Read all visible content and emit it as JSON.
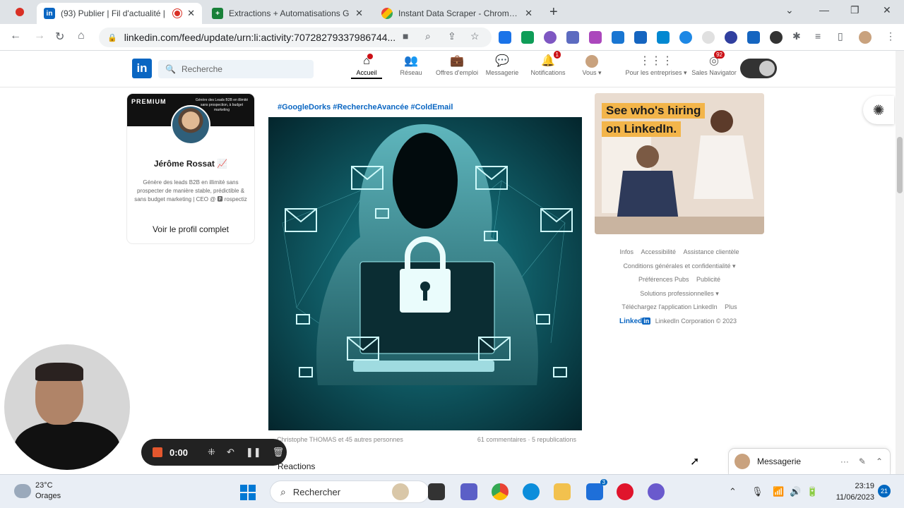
{
  "browser": {
    "tabs": [
      {
        "title": "(93) Publier | Fil d'actualité |",
        "favicon_color": "#0a66c2",
        "favicon_text": "in",
        "active": true
      },
      {
        "title": "Extractions + Automatisations G",
        "favicon_color": "#188038",
        "favicon_text": "+",
        "active": false
      },
      {
        "title": "Instant Data Scraper - Chrome W",
        "favicon_color": "#f4b400",
        "favicon_text": "",
        "active": false
      }
    ],
    "url": "linkedin.com/feed/update/urn:li:activity:70728279337986744..."
  },
  "linkedin": {
    "logo_text": "in",
    "search_placeholder": "Recherche",
    "nav": [
      {
        "label": "Accueil",
        "icon": "home-icon",
        "glyph": "⌂",
        "badge": "",
        "active": true
      },
      {
        "label": "Réseau",
        "icon": "network-icon",
        "glyph": "👥",
        "badge": "",
        "active": false
      },
      {
        "label": "Offres d'emploi",
        "icon": "briefcase-icon",
        "glyph": "💼",
        "badge": "",
        "active": false
      },
      {
        "label": "Messagerie",
        "icon": "messaging-icon",
        "glyph": "💬",
        "badge": "",
        "active": false
      },
      {
        "label": "Notifications",
        "icon": "bell-icon",
        "glyph": "🔔",
        "badge": "1",
        "active": false
      },
      {
        "label": "Vous ▾",
        "icon": "avatar-icon",
        "glyph": "",
        "badge": "",
        "active": false
      },
      {
        "label": "Pour les entreprises ▾",
        "icon": "grid-icon",
        "glyph": "⋮⋮⋮",
        "badge": "",
        "active": false
      },
      {
        "label": "Sales Navigator",
        "icon": "compass-icon",
        "glyph": "◎",
        "badge": "92",
        "active": false
      }
    ]
  },
  "profile": {
    "banner_label": "PREMIUM",
    "banner_text": "Génère des Leads B2B en illimité sans prospection, à budget marketing",
    "name": "Jérôme Rossat 📈",
    "bio": "Génère des leads B2B en illimité sans prospecter de manière stable, prédictible & sans budget marketing | CEO @ 🅿 rospectiz",
    "view_profile": "Voir le profil complet"
  },
  "post": {
    "hashtags": "#GoogleDorks #RechercheAvancée #ColdEmail",
    "reactions_summary": "Christophe THOMAS et 45 autres personnes",
    "comments_reposts": "61 commentaires · 5 republications",
    "reactions_title": "Reactions"
  },
  "ad": {
    "line1": "See who's hiring",
    "line2": "on LinkedIn."
  },
  "footer": {
    "row1": [
      "Infos",
      "Accessibilité",
      "Assistance clientèle"
    ],
    "row2": "Conditions générales et confidentialité ▾",
    "row3": [
      "Préférences Pubs",
      "Publicité"
    ],
    "row4": "Solutions professionnelles ▾",
    "row5": [
      "Téléchargez l'application LinkedIn",
      "Plus"
    ],
    "corp_logo": "Linked",
    "corp_text": "LinkedIn Corporation © 2023"
  },
  "messaging": {
    "label": "Messagerie"
  },
  "recorder": {
    "time": "0:00"
  },
  "taskbar": {
    "temperature": "23°C",
    "weather": "Orages",
    "search": "Rechercher",
    "time": "23:19",
    "date": "11/06/2023",
    "notifications": "21",
    "mail_badge": "3"
  }
}
